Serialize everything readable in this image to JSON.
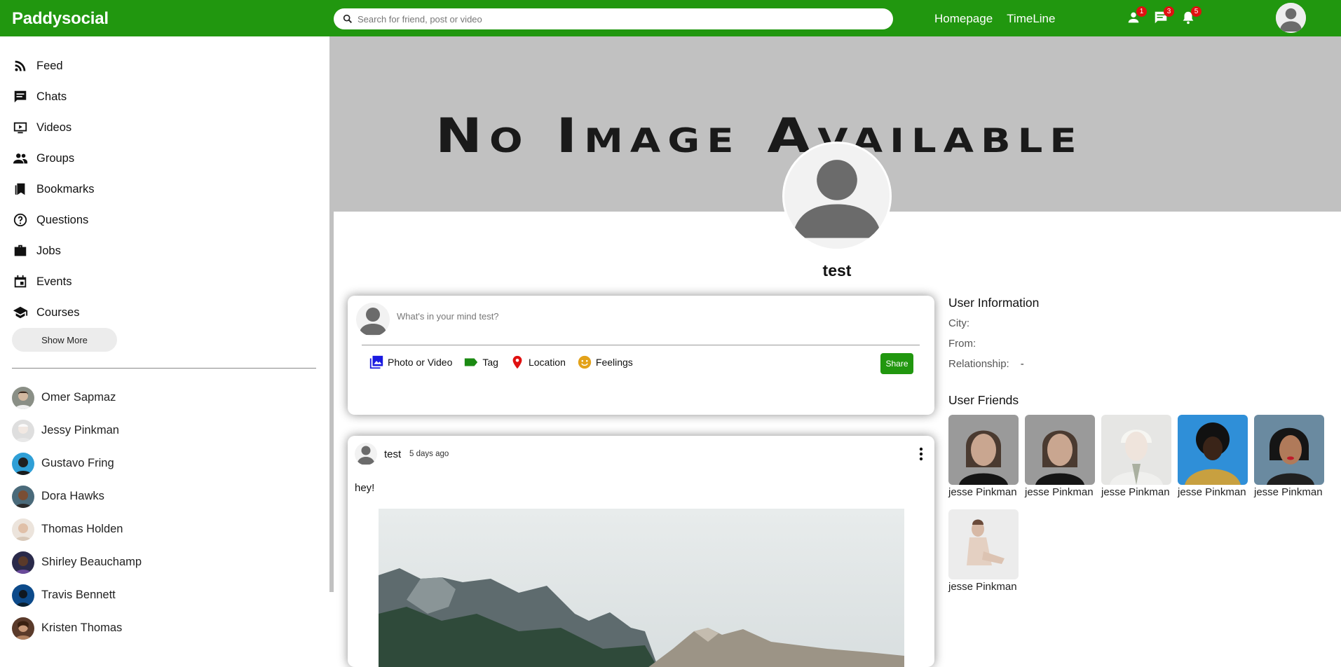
{
  "header": {
    "logo": "Paddysocial",
    "search_placeholder": "Search for friend, post or video",
    "nav": [
      "Homepage",
      "TimeLine"
    ],
    "badges": {
      "friends": "1",
      "chats": "3",
      "notifications": "5"
    },
    "brand_color": "#21970f"
  },
  "sidebar": {
    "menu": [
      {
        "label": "Feed",
        "icon": "rss-feed-icon"
      },
      {
        "label": "Chats",
        "icon": "chat-icon"
      },
      {
        "label": "Videos",
        "icon": "play-video-icon"
      },
      {
        "label": "Groups",
        "icon": "group-icon"
      },
      {
        "label": "Bookmarks",
        "icon": "bookmark-icon"
      },
      {
        "label": "Questions",
        "icon": "help-circle-icon"
      },
      {
        "label": "Jobs",
        "icon": "briefcase-icon"
      },
      {
        "label": "Events",
        "icon": "calendar-icon"
      },
      {
        "label": "Courses",
        "icon": "school-icon"
      }
    ],
    "show_more": "Show More",
    "friends": [
      "Omer Sapmaz",
      "Jessy Pinkman",
      "Gustavo Fring",
      "Dora Hawks",
      "Thomas Holden",
      "Shirley Beauchamp",
      "Travis Bennett",
      "Kristen Thomas"
    ]
  },
  "profile": {
    "cover_text": "No Image Available",
    "name": "test"
  },
  "share": {
    "placeholder": "What's in your mind test?",
    "options": [
      "Photo or Video",
      "Tag",
      "Location",
      "Feelings"
    ],
    "button": "Share"
  },
  "post": {
    "user": "test",
    "time": "5 days ago",
    "text": "hey!"
  },
  "user_info": {
    "title": "User Information",
    "rows": [
      {
        "label": "City:",
        "value": ""
      },
      {
        "label": "From:",
        "value": ""
      },
      {
        "label": "Relationship:",
        "value": "-"
      }
    ]
  },
  "user_friends": {
    "title": "User Friends",
    "names": [
      "jesse Pinkman",
      "jesse Pinkman",
      "jesse Pinkman",
      "jesse Pinkman",
      "jesse Pinkman",
      "jesse Pinkman"
    ]
  }
}
